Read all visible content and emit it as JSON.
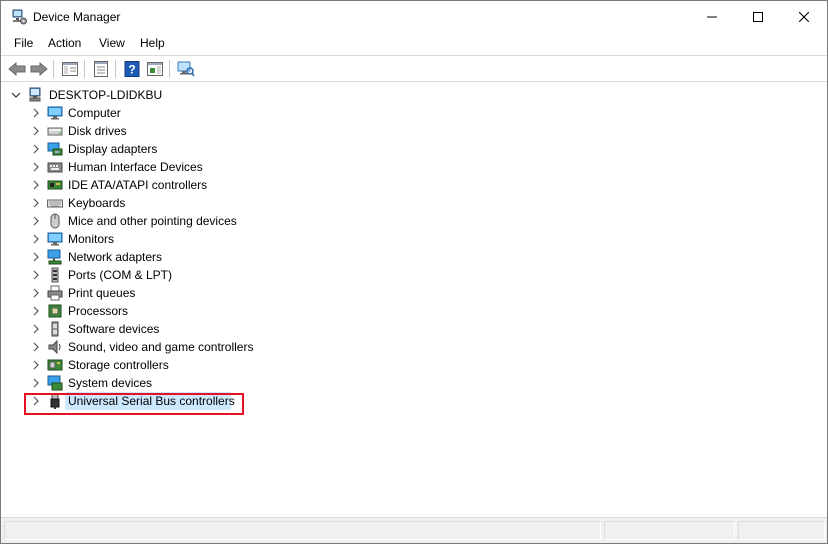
{
  "window": {
    "title": "Device Manager",
    "controls": {
      "minimize": "minimize",
      "maximize": "maximize",
      "close": "close"
    }
  },
  "menu": [
    "File",
    "Action",
    "View",
    "Help"
  ],
  "toolbar": {
    "buttons": [
      "back-icon",
      "forward-icon",
      "show-hide-console-tree-icon",
      "properties-icon",
      "help-icon",
      "action-pane-icon",
      "scan-hardware-icon"
    ]
  },
  "tree": {
    "root": {
      "label": "DESKTOP-LDIDKBU",
      "expanded": true,
      "icon": "computer-tower-icon"
    },
    "children": [
      {
        "label": "Computer",
        "icon": "monitor-icon"
      },
      {
        "label": "Disk drives",
        "icon": "disk-drive-icon"
      },
      {
        "label": "Display adapters",
        "icon": "display-adapter-icon"
      },
      {
        "label": "Human Interface Devices",
        "icon": "hid-icon"
      },
      {
        "label": "IDE ATA/ATAPI controllers",
        "icon": "ide-controller-icon"
      },
      {
        "label": "Keyboards",
        "icon": "keyboard-icon"
      },
      {
        "label": "Mice and other pointing devices",
        "icon": "mouse-icon"
      },
      {
        "label": "Monitors",
        "icon": "monitor-icon"
      },
      {
        "label": "Network adapters",
        "icon": "network-adapter-icon"
      },
      {
        "label": "Ports (COM & LPT)",
        "icon": "port-icon"
      },
      {
        "label": "Print queues",
        "icon": "printer-icon"
      },
      {
        "label": "Processors",
        "icon": "processor-icon"
      },
      {
        "label": "Software devices",
        "icon": "software-device-icon"
      },
      {
        "label": "Sound, video and game controllers",
        "icon": "speaker-icon"
      },
      {
        "label": "Storage controllers",
        "icon": "storage-controller-icon"
      },
      {
        "label": "System devices",
        "icon": "system-device-icon"
      },
      {
        "label": "Universal Serial Bus controllers",
        "icon": "usb-icon",
        "selected": true
      }
    ]
  },
  "colors": {
    "selection": "#cce8ff",
    "highlight_border": "#e81123",
    "help_icon": "#1e5bb5"
  }
}
